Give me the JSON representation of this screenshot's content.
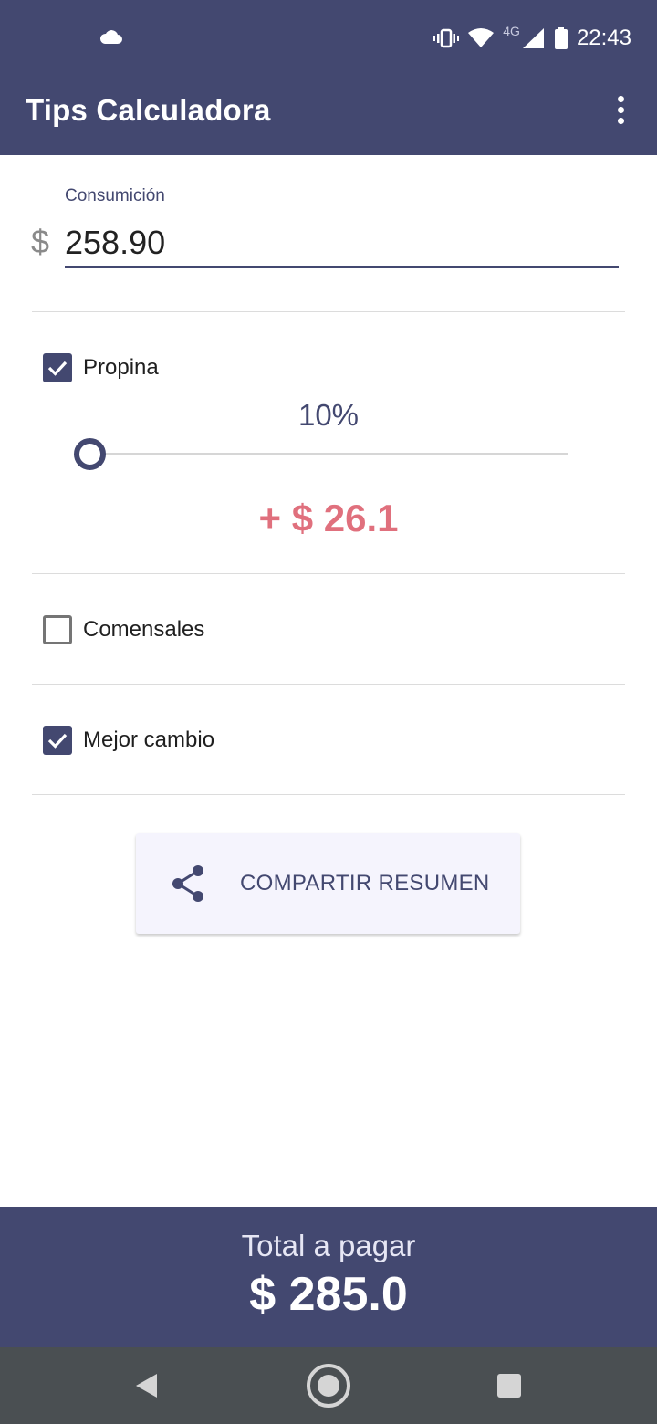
{
  "status_bar": {
    "network_label": "4G",
    "time": "22:43",
    "icons": [
      "cloud-icon",
      "vibrate-icon",
      "wifi-icon",
      "signal-icon",
      "battery-icon"
    ]
  },
  "app_bar": {
    "title": "Tips Calculadora",
    "overflow_icon": "more-vert-icon"
  },
  "consumption": {
    "label": "Consumición",
    "currency_symbol": "$",
    "value": "258.90"
  },
  "tip": {
    "checkbox_label": "Propina",
    "checked": true,
    "percent_text": "10%",
    "slider_value_percent": 10,
    "amount_text": "+ $ 26.1"
  },
  "diners": {
    "checkbox_label": "Comensales",
    "checked": false
  },
  "best_change": {
    "checkbox_label": "Mejor cambio",
    "checked": true
  },
  "share_button": {
    "label": "COMPARTIR RESUMEN",
    "icon": "share-icon"
  },
  "total": {
    "label": "Total a pagar",
    "value": "$ 285.0"
  },
  "colors": {
    "primary": "#434870",
    "tip_amount": "#e0707d",
    "nav_bar": "#4a4f52"
  }
}
